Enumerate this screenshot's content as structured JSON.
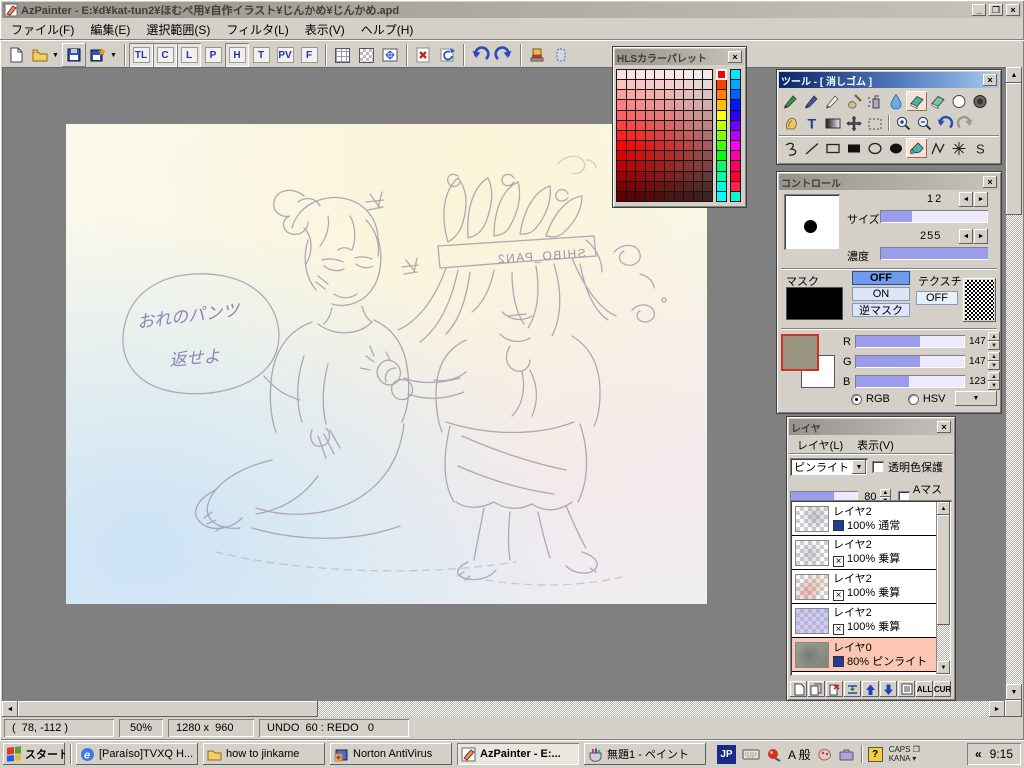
{
  "window": {
    "title": "AzPainter - E:¥d¥kat-tun2¥ほむぺ用¥自作イラスト¥じんかめ¥じんかめ.apd"
  },
  "menubar": {
    "items": [
      "ファイル(F)",
      "編集(E)",
      "選択範囲(S)",
      "フィルタ(L)",
      "表示(V)",
      "ヘルプ(H)"
    ]
  },
  "toolbar": {
    "toggles": [
      "TL",
      "C",
      "L",
      "P",
      "H",
      "T",
      "PV",
      "F"
    ]
  },
  "palette_window": {
    "title": "HLSカラーパレット",
    "grid": {
      "rows": 13,
      "cols": 10,
      "hue": 0
    },
    "hues_left": [
      "#ff0000",
      "#ff4000",
      "#ff8000",
      "#ffbf00",
      "#ffff00",
      "#bfff00",
      "#7fff00",
      "#40ff00",
      "#00ff10",
      "#00ff60",
      "#00ffa8",
      "#00ffe0",
      "#00ffff"
    ],
    "hues_right": [
      "#00e8ff",
      "#00a8ff",
      "#0060ff",
      "#0018ff",
      "#2800ff",
      "#7000ff",
      "#b800ff",
      "#ff00f0",
      "#ff00a8",
      "#ff0060",
      "#ff0028",
      "#ff2050",
      "#00ffd0"
    ]
  },
  "tool_window": {
    "title": "ツール - [ 消しゴム ]",
    "glyphs": {
      "text_tool": "T",
      "spline_tool": "S"
    }
  },
  "control_window": {
    "title": "コントロール",
    "size_label": "サイズ",
    "size_value": "12",
    "density_label": "濃度",
    "density_value": "255",
    "mask_label": "マスク",
    "mask_off": "OFF",
    "mask_on": "ON",
    "mask_invert": "逆マスク",
    "texture_label": "テクスチャ",
    "texture_off": "OFF",
    "channels": [
      {
        "label": "R",
        "value": "147"
      },
      {
        "label": "G",
        "value": "147"
      },
      {
        "label": "B",
        "value": "123"
      }
    ],
    "rgb_label": "RGB",
    "hsv_label": "HSV",
    "fg_color": "#9a9580",
    "bg_color": "#ffffff"
  },
  "layer_window": {
    "title": "レイヤ",
    "menu_items": [
      "レイヤ(L)",
      "表示(V)"
    ],
    "blend_mode": "ピンライト",
    "protect_label": "透明色保護",
    "opacity_value": "80",
    "amask_label": "Aマスク",
    "layers": [
      {
        "name": "レイヤ2",
        "info": "100% 通常"
      },
      {
        "name": "レイヤ2",
        "info": "100% 乗算"
      },
      {
        "name": "レイヤ2",
        "info": "100% 乗算"
      },
      {
        "name": "レイヤ2",
        "info": "100% 乗算"
      },
      {
        "name": "レイヤ0",
        "info": "80%  ピンライト"
      }
    ],
    "buttons": {
      "all": "ALL",
      "cur": "CUR"
    }
  },
  "canvas": {
    "bubble_line1": "おれのパンツ",
    "bubble_line2": "返せよ",
    "crown_text": "SHIBO_PAN2"
  },
  "statusbar": {
    "coords": "(  78, -112 )",
    "zoom": "50%",
    "size": "1280 x  960",
    "history": "UNDO  60 : REDO   0"
  },
  "taskbar": {
    "start_label": "スタート",
    "tasks": [
      {
        "label": "[Paraíso]TVXQ H..."
      },
      {
        "label": "how to jinkame"
      },
      {
        "label": "Norton AntiVirus"
      },
      {
        "label": "AzPainter - E:..."
      },
      {
        "label": "無題1 - ペイント"
      }
    ],
    "ie_glyph": "e",
    "lang_indicator": "JP",
    "ime_mode": "A 般",
    "caps_label": "CAPS",
    "kana_label": "KANA",
    "tray_chevron": "«",
    "clock": "9:15"
  }
}
